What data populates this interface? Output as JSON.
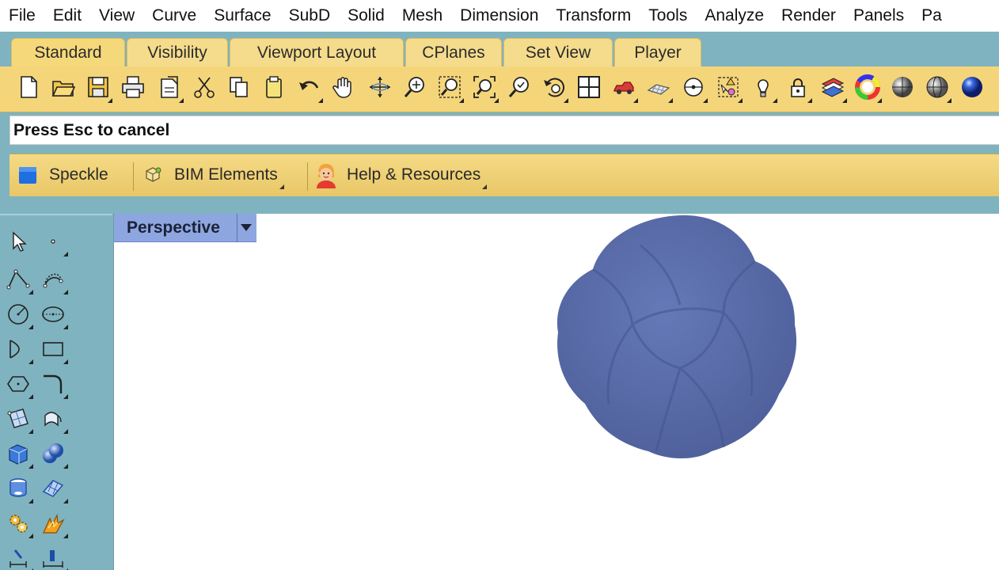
{
  "menu": [
    "File",
    "Edit",
    "View",
    "Curve",
    "Surface",
    "SubD",
    "Solid",
    "Mesh",
    "Dimension",
    "Transform",
    "Tools",
    "Analyze",
    "Render",
    "Panels",
    "Pa"
  ],
  "tabs": [
    "Standard",
    "Visibility",
    "Viewport Layout",
    "CPlanes",
    "Set View",
    "Player"
  ],
  "command_prompt": "Press Esc to cancel",
  "plugins": {
    "speckle": "Speckle",
    "bim": "BIM Elements",
    "help": "Help & Resources"
  },
  "viewport": {
    "name": "Perspective",
    "object_color": "#5b6eab"
  },
  "colors": {
    "background": "#7fb3bf",
    "toolbar": "#f4d57a",
    "tab": "#f5dc8c",
    "viewport_tab": "#8da6e0"
  }
}
